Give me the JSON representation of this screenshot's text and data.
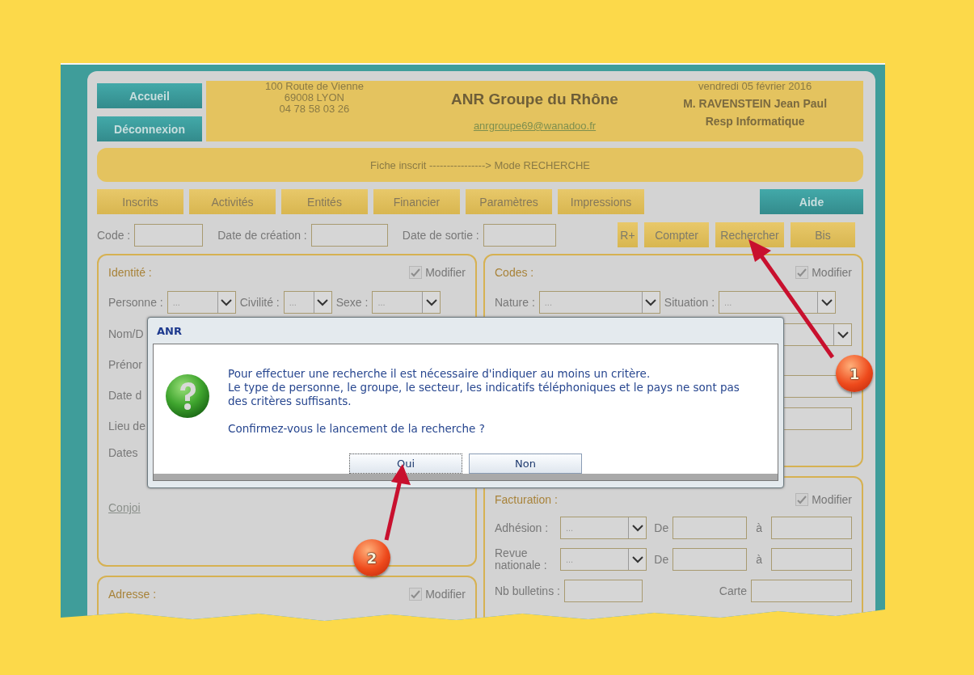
{
  "header": {
    "nav_buttons": [
      "Accueil",
      "Déconnexion"
    ],
    "address": [
      "100 Route de Vienne",
      "69008 LYON",
      "04 78 58 03 26"
    ],
    "title": "ANR Groupe du Rhône",
    "email": "anrgroupe69@wanadoo.fr",
    "date": "vendredi 05 février 2016",
    "user": "M. RAVENSTEIN Jean Paul",
    "role": "Resp Informatique"
  },
  "mode_bar": "Fiche inscrit ----------------> Mode RECHERCHE",
  "tabs": [
    {
      "label": "Inscrits",
      "kind": "tab"
    },
    {
      "label": "Activités",
      "kind": "tab"
    },
    {
      "label": "Entités",
      "kind": "tab"
    },
    {
      "label": "Financier",
      "kind": "tab"
    },
    {
      "label": "Paramètres",
      "kind": "tab"
    },
    {
      "label": "Impressions",
      "kind": "tab"
    },
    {
      "label": "Aide",
      "kind": "help"
    }
  ],
  "search_row": {
    "fields": [
      {
        "label": "Code :"
      },
      {
        "label": "Date de création :"
      },
      {
        "label": "Date de sortie :"
      }
    ],
    "buttons": [
      "R+",
      "Compter",
      "Rechercher",
      "Bis"
    ]
  },
  "identity_panel": {
    "title": "Identité :",
    "modify": {
      "label": "Modifier",
      "checked": true
    },
    "selects": [
      {
        "label": "Personne :",
        "value": "..."
      },
      {
        "label": "Civilité :",
        "value": "..."
      },
      {
        "label": "Sexe :",
        "value": "..."
      }
    ],
    "labels": [
      "Nom/D",
      "Prénor",
      "Date d",
      "Lieu de",
      "Dates"
    ],
    "link": "Conjoi"
  },
  "address_panel": {
    "title": "Adresse :",
    "modify": {
      "label": "Modifier",
      "checked": true
    }
  },
  "codes_panel": {
    "title": "Codes :",
    "modify": {
      "label": "Modifier",
      "checked": true
    },
    "selects": [
      {
        "label": "Nature :",
        "value": "..."
      },
      {
        "label": "Situation :",
        "value": "..."
      }
    ]
  },
  "billing_panel": {
    "title": "Facturation :",
    "modify": {
      "label": "Modifier",
      "checked": true
    },
    "rows": [
      {
        "label": "Adhésion :",
        "value": "...",
        "from": "De",
        "to": "à"
      },
      {
        "label": "Revue nationale :",
        "value": "...",
        "from": "De",
        "to": "à"
      }
    ],
    "bulletins_label": "Nb bulletins :",
    "card_label": "Carte"
  },
  "dialog": {
    "title": "ANR",
    "lines": [
      "Pour effectuer une recherche il est nécessaire d'indiquer au moins un critère.",
      "Le type de personne, le groupe, le secteur, les indicatifs téléphoniques et le pays ne sont pas des critères suffisants."
    ],
    "question": "Confirmez-vous le lancement de la recherche ?",
    "buttons": [
      {
        "label": "Oui",
        "focused": true
      },
      {
        "label": "Non",
        "focused": false
      }
    ]
  },
  "annotations": [
    {
      "number": "1"
    },
    {
      "number": "2"
    }
  ]
}
